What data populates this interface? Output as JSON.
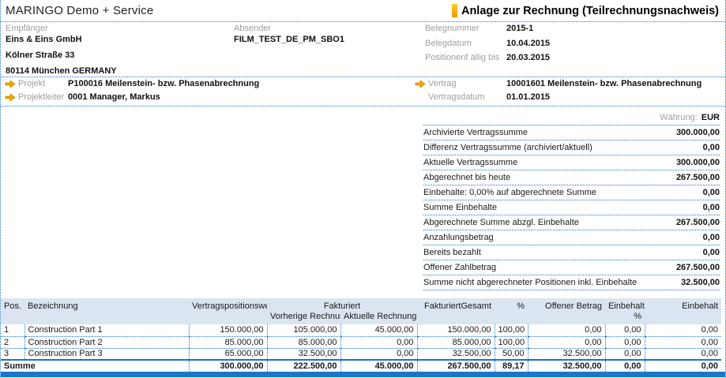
{
  "header": {
    "company": "MARINGO Demo + Service",
    "title": "Anlage zur Rechnung (Teilrechnungsnachweis)"
  },
  "recipient": {
    "label": "Empfänger",
    "name": "Eins & Eins GmbH",
    "street": "Kölner Straße 33",
    "city": "80114 München GERMANY"
  },
  "sender": {
    "label": "Absender",
    "value": "FILM_TEST_DE_PM_SBO1"
  },
  "doc_fields": [
    {
      "label": "Belegnummer",
      "value": "2015-1"
    },
    {
      "label": "Belegdatum",
      "value": "10.04.2015"
    },
    {
      "label": "Positionenf ällig bis",
      "value": "20.03.2015"
    }
  ],
  "project": {
    "projekt": {
      "label": "Projekt",
      "value": "P100016 Meilenstein- bzw. Phasenabrechnung"
    },
    "projektleiter": {
      "label": "Projektleiter",
      "value": "0001 Manager, Markus"
    },
    "vertrag": {
      "label": "Vertrag",
      "value": "10001601 Meilenstein- bzw. Phasenabrechnung"
    },
    "vertragsdatum": {
      "label": "Vertragsdatum",
      "value": "01.01.2015"
    }
  },
  "currency": {
    "label": "Währung:",
    "value": "EUR"
  },
  "summary": {
    "rows": [
      {
        "label": "Archivierte Vertragssumme",
        "value": "300.000,00"
      },
      {
        "label": "Differenz Vertragssumme (archiviert/aktuell)",
        "value": "0,00"
      },
      {
        "label": "Aktuelle Vertragssumme",
        "value": "300.000,00"
      },
      {
        "label": "Abgerechnet bis heute",
        "value": "267.500,00"
      },
      {
        "label": "Einbehalte: 0,00% auf abgerechnete Summe",
        "value": "0,00"
      },
      {
        "label": "Summe Einbehalte",
        "value": "0,00"
      },
      {
        "label": "Abgerechnete Summe abzgl. Einbehalte",
        "value": "267.500,00"
      },
      {
        "label": "Anzahlungsbetrag",
        "value": "0,00"
      },
      {
        "label": "Bereits bezahlt",
        "value": "0,00"
      },
      {
        "label": "Offener Zahlbetrag",
        "value": "267.500,00"
      },
      {
        "label": "Summe nicht abgerechneter Positionen inkl. Einbehalte",
        "value": "32.500,00"
      }
    ]
  },
  "positions": {
    "headers": {
      "pos": "Pos.",
      "bezeichnung": "Bezeichnung",
      "vertragspositionswert": "Vertragspositionswert",
      "fakturiert": "Fakturiert",
      "vorherige_rechnungen": "Vorherige Rechnungen",
      "aktuelle_rechnung": "Aktuelle Rechnung",
      "fakturiert_gesamt": "FakturiertGesamt",
      "prozent": "%",
      "offener_betrag": "Offener Betrag",
      "einbehalt_grp": "Einbehalt",
      "einbehalt_prozent": "%",
      "einbehalt": "Einbehalt"
    },
    "rows": [
      {
        "pos": "1",
        "bezeichnung": "Construction Part 1",
        "wert": "150.000,00",
        "vorherige": "105.000,00",
        "aktuelle": "45.000,00",
        "gesamt": "150.000,00",
        "prozent": "100,00",
        "offener": "0,00",
        "einbehalt_prozent": "0,00",
        "einbehalt": "0,00"
      },
      {
        "pos": "2",
        "bezeichnung": "Construction Part 2",
        "wert": "85.000,00",
        "vorherige": "85.000,00",
        "aktuelle": "0,00",
        "gesamt": "85.000,00",
        "prozent": "100,00",
        "offener": "0,00",
        "einbehalt_prozent": "0,00",
        "einbehalt": "0,00"
      },
      {
        "pos": "3",
        "bezeichnung": "Construction Part 3",
        "wert": "65.000,00",
        "vorherige": "32.500,00",
        "aktuelle": "0,00",
        "gesamt": "32.500,00",
        "prozent": "50,00",
        "offener": "32.500,00",
        "einbehalt_prozent": "0,00",
        "einbehalt": "0,00"
      }
    ],
    "total": {
      "label": "Summe",
      "wert": "300.000,00",
      "vorherige": "222.500,00",
      "aktuelle": "45.000,00",
      "gesamt": "267.500,00",
      "prozent": "89,17",
      "offener": "32.500,00",
      "einbehalt_prozent": "0,00",
      "einbehalt": "0,00"
    }
  },
  "colors": {
    "accent_blue": "#1876cd",
    "accent_gold": "#f0a500",
    "table_header_bg": "#dbe5f1",
    "label_gray": "#9e9e9e"
  }
}
